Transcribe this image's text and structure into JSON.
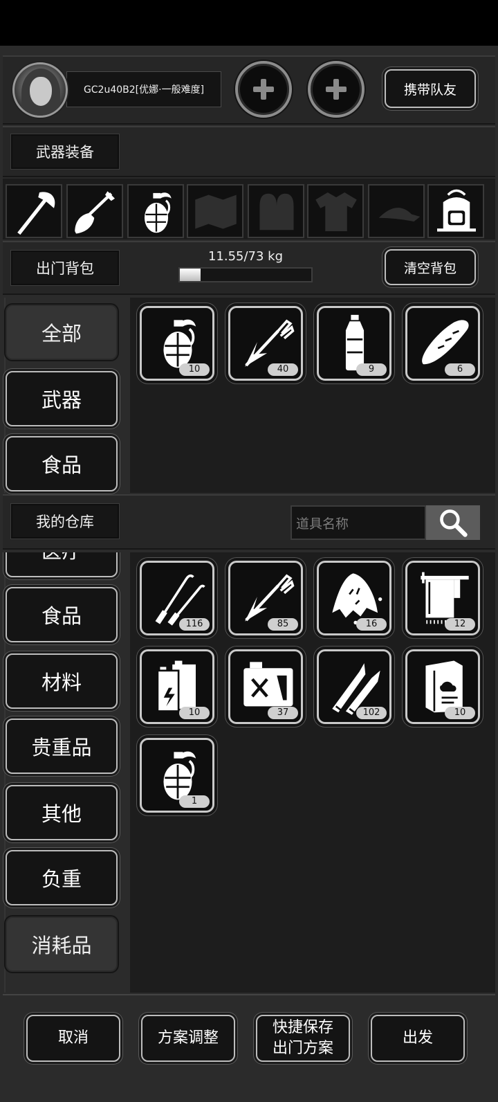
{
  "header": {
    "player_name": "GC2u40B2[优娜·一般难度]",
    "bring_teammate_label": "携带队友"
  },
  "equipment": {
    "title": "武器装备",
    "slots": [
      "axe-icon",
      "shovel-icon",
      "grenade-icon",
      "map-icon",
      "gloves-icon",
      "shirt-icon",
      "cap-icon",
      "backpack-icon"
    ]
  },
  "backpack": {
    "title": "出门背包",
    "weight_text": "11.55/73 kg",
    "weight_fraction": 0.158,
    "clear_label": "清空背包",
    "categories": [
      "全部",
      "武器",
      "食品"
    ],
    "items": [
      {
        "icon": "grenade-icon",
        "count": "10"
      },
      {
        "icon": "arrow-icon",
        "count": "40"
      },
      {
        "icon": "water-bottle-icon",
        "count": "9"
      },
      {
        "icon": "bread-icon",
        "count": "6"
      }
    ]
  },
  "warehouse": {
    "title": "我的仓库",
    "search_placeholder": "道具名称",
    "categories": [
      "医疗",
      "食品",
      "材料",
      "贵重品",
      "其他",
      "负重",
      "消耗品"
    ],
    "items": [
      {
        "icon": "lockpick-icon",
        "count": "116"
      },
      {
        "icon": "arrow-icon",
        "count": "85"
      },
      {
        "icon": "cloth-rag-icon",
        "count": "16"
      },
      {
        "icon": "towel-icon",
        "count": "12"
      },
      {
        "icon": "battery-icon",
        "count": "10"
      },
      {
        "icon": "fuel-can-icon",
        "count": "37"
      },
      {
        "icon": "bullet-icon",
        "count": "102"
      },
      {
        "icon": "book-icon",
        "count": "10"
      },
      {
        "icon": "grenade-icon",
        "count": "1"
      }
    ]
  },
  "footer": {
    "cancel": "取消",
    "adjust": "方案调整",
    "quick_save_line1": "快捷保存",
    "quick_save_line2": "出门方案",
    "depart": "出发"
  }
}
